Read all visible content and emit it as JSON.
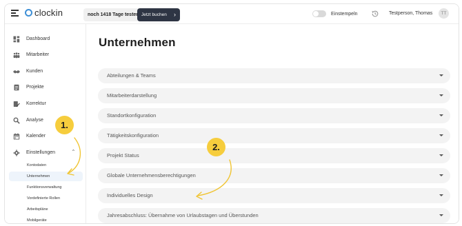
{
  "header": {
    "app_name": "clockin",
    "trial_text": "noch 1418 Tage testen",
    "buy_button": "Jetzt buchen",
    "clock_in_label": "Einstempeln",
    "user_name": "Testperson, Thomas",
    "avatar_initials": "TT"
  },
  "sidebar": {
    "items": [
      {
        "label": "Dashboard",
        "icon": "dashboard-icon"
      },
      {
        "label": "Mitarbeiter",
        "icon": "people-icon"
      },
      {
        "label": "Kunden",
        "icon": "handshake-icon"
      },
      {
        "label": "Projekte",
        "icon": "clipboard-icon"
      },
      {
        "label": "Korrektur",
        "icon": "edit-icon"
      },
      {
        "label": "Analyse",
        "icon": "magnifier-icon"
      },
      {
        "label": "Kalender",
        "icon": "calendar-icon"
      },
      {
        "label": "Einstellungen",
        "icon": "gear-icon"
      }
    ],
    "settings_sub": [
      {
        "label": "Kontodaten",
        "active": false
      },
      {
        "label": "Unternehmen",
        "active": true
      },
      {
        "label": "Funktionsverwaltung",
        "active": false
      },
      {
        "label": "Vordefinierte Rollen",
        "active": false
      },
      {
        "label": "Arbeitspläne",
        "active": false
      },
      {
        "label": "Mobilgeräte",
        "active": false
      }
    ]
  },
  "main": {
    "title": "Unternehmen",
    "sections": [
      "Abteilungen & Teams",
      "Mitarbeiterdarstellung",
      "Standortkonfiguration",
      "Tätigkeitskonfiguration",
      "Projekt Status",
      "Globale Unternehmensberechtigungen",
      "Individuelles Design",
      "Jahresabschluss: Übernahme von Urlaubstagen und Überstunden"
    ]
  },
  "annotations": {
    "step1": "1.",
    "step2": "2."
  },
  "colors": {
    "brand_blue": "#3d8fd6",
    "buy_button_bg": "#2e3544",
    "annotation_yellow": "#f6cd3d",
    "active_sub_bg": "#eef4fb"
  }
}
